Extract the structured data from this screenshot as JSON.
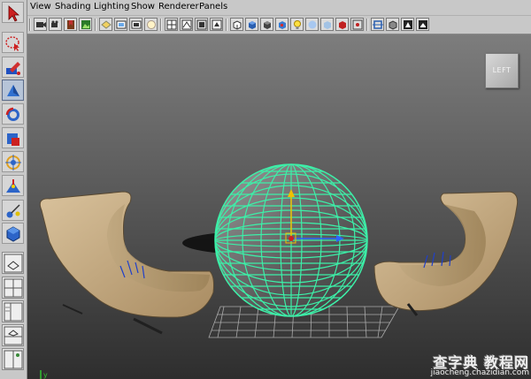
{
  "menubar": {
    "items": [
      "View",
      "Shading",
      "Lighting",
      "Show",
      "Renderer",
      "Panels"
    ]
  },
  "viewcube": {
    "label": "LEFT"
  },
  "watermark": {
    "title": "查字典 教程网",
    "url": "jiaocheng.chazidian.com"
  },
  "colors": {
    "wireframe": "#3cf0a8",
    "chair": "#c9b28e",
    "viewport_top": "#7d7d7d",
    "viewport_bottom": "#2e2e2e"
  }
}
